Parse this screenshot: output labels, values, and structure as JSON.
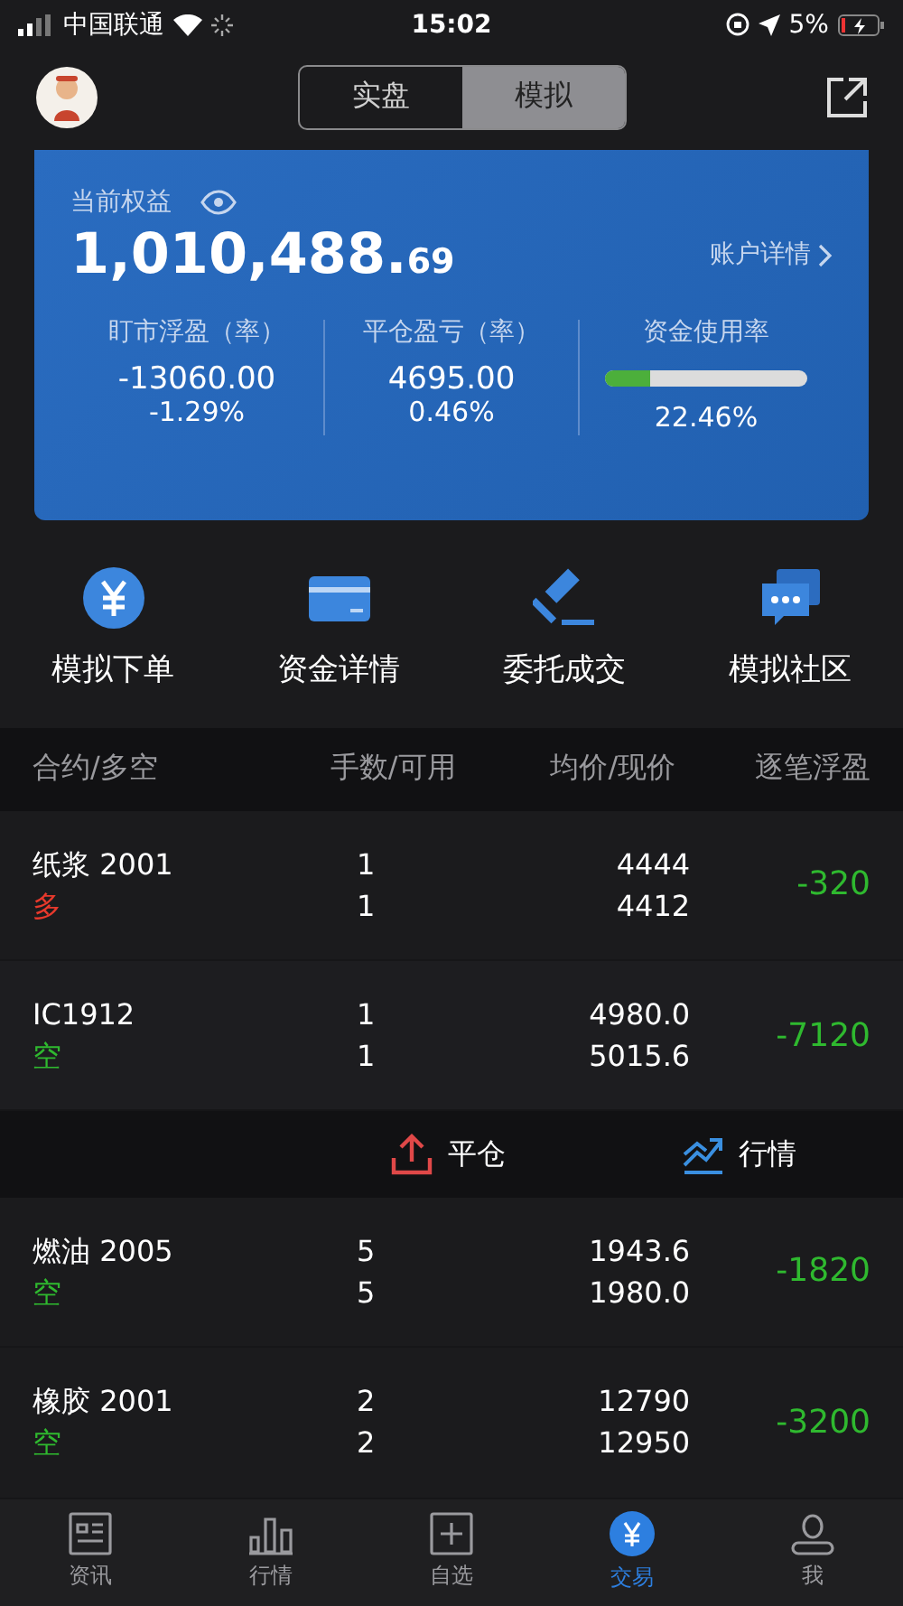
{
  "status_bar": {
    "carrier": "中国联通",
    "time": "15:02",
    "battery": "5%"
  },
  "mode_tabs": [
    {
      "label": "实盘",
      "selected": false
    },
    {
      "label": "模拟",
      "selected": true
    }
  ],
  "account": {
    "label": "当前权益",
    "equity_main": "1,010,488.",
    "equity_fraction": "69",
    "detail_link": "账户详情",
    "stats": [
      {
        "kind": "value",
        "label": "盯市浮盈（率）",
        "value": "-13060.00",
        "rate": "-1.29%"
      },
      {
        "kind": "value",
        "label": "平仓盈亏（率）",
        "value": "4695.00",
        "rate": "0.46%"
      },
      {
        "kind": "meter",
        "label": "资金使用率",
        "level": 0.2246,
        "rate": "22.46%"
      }
    ]
  },
  "actions": [
    {
      "kind": "yuan",
      "label": "模拟下单"
    },
    {
      "kind": "card",
      "label": "资金详情"
    },
    {
      "kind": "gavel",
      "label": "委托成交"
    },
    {
      "kind": "chat",
      "label": "模拟社区"
    }
  ],
  "table": {
    "columns": [
      "合约/多空",
      "手数/可用",
      "均价/现价",
      "逐笔浮盈"
    ],
    "rows": [
      {
        "contract": "纸浆 2001",
        "kind": "long",
        "side_label": "多",
        "lots": "1",
        "available": "1",
        "avg_price": "4444",
        "last_price": "4412",
        "pnl": "-320",
        "selected": false
      },
      {
        "contract": "IC1912",
        "kind": "short",
        "side_label": "空",
        "lots": "1",
        "available": "1",
        "avg_price": "4980.0",
        "last_price": "5015.6",
        "pnl": "-7120",
        "selected": true
      },
      {
        "contract": "燃油 2005",
        "kind": "short",
        "side_label": "空",
        "lots": "5",
        "available": "5",
        "avg_price": "1943.6",
        "last_price": "1980.0",
        "pnl": "-1820",
        "selected": false
      },
      {
        "contract": "橡胶 2001",
        "kind": "short",
        "side_label": "空",
        "lots": "2",
        "available": "2",
        "avg_price": "12790",
        "last_price": "12950",
        "pnl": "-3200",
        "selected": false
      }
    ],
    "row_actions": [
      {
        "kind": "close",
        "label": "平仓"
      },
      {
        "kind": "quote",
        "label": "行情"
      }
    ]
  },
  "tab_bar": [
    {
      "kind": "news",
      "label": "资讯",
      "selected": false
    },
    {
      "kind": "market",
      "label": "行情",
      "selected": false
    },
    {
      "kind": "watch",
      "label": "自选",
      "selected": false
    },
    {
      "kind": "trade",
      "label": "交易",
      "selected": true
    },
    {
      "kind": "me",
      "label": "我",
      "selected": false
    }
  ]
}
